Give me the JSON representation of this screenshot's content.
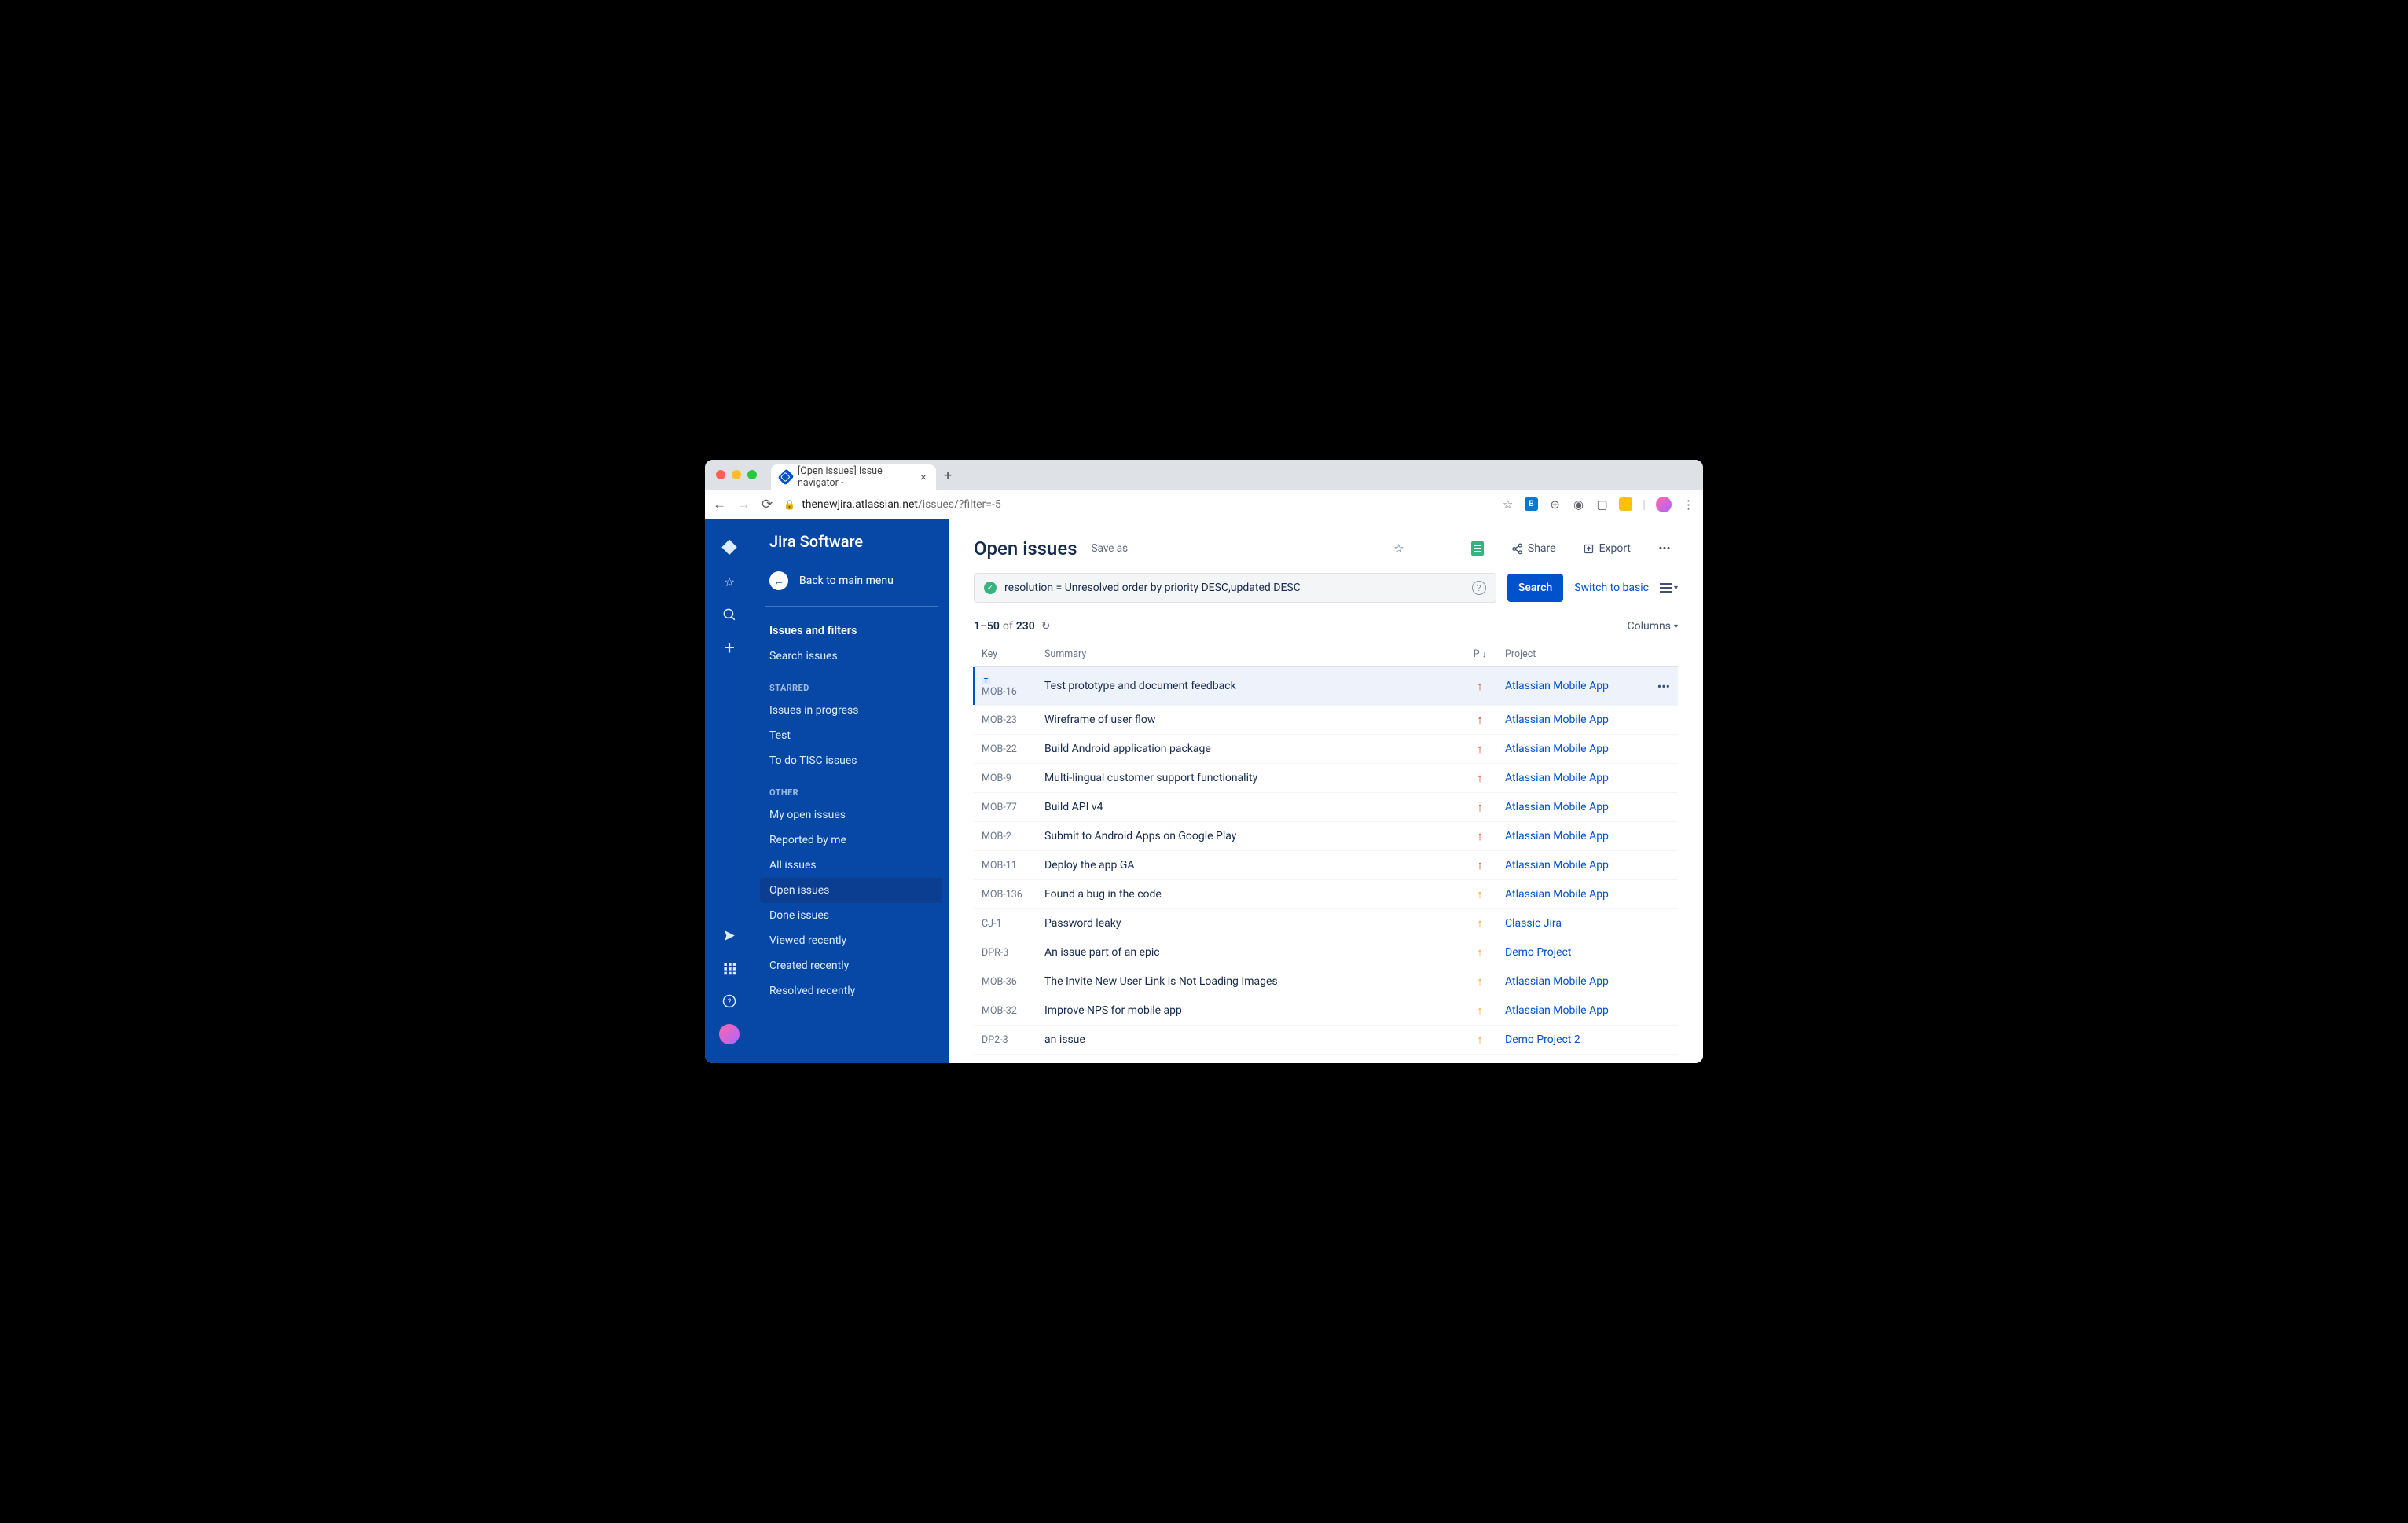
{
  "browser": {
    "tab_title": "[Open issues] Issue navigator - ",
    "url_host": "thenewjira.atlassian.net",
    "url_path": "/issues/?filter=-5"
  },
  "sidebar": {
    "brand": "Jira Software",
    "back": "Back to main menu",
    "section_head": "Issues and filters",
    "search_issues": "Search issues",
    "starred_label": "STARRED",
    "starred": [
      "Issues in progress",
      "Test",
      "To do TISC issues"
    ],
    "other_label": "OTHER",
    "other": [
      "My open issues",
      "Reported by me",
      "All issues",
      "Open issues",
      "Done issues",
      "Viewed recently",
      "Created recently",
      "Resolved recently"
    ],
    "active_other_index": 3
  },
  "header": {
    "title": "Open issues",
    "save_as": "Save as",
    "share": "Share",
    "export": "Export"
  },
  "query": {
    "jql": "resolution = Unresolved order by priority DESC,updated DESC",
    "search_btn": "Search",
    "switch": "Switch to basic"
  },
  "count": {
    "range": "1–50",
    "of_label": "of",
    "total": "230"
  },
  "columns_btn": "Columns",
  "columns": {
    "key": "Key",
    "summary": "Summary",
    "p": "P",
    "project": "Project"
  },
  "rows": [
    {
      "key": "MOB-16",
      "summary": "Test prototype and document feedback",
      "prio": "high",
      "project": "Atlassian Mobile App",
      "selected": true
    },
    {
      "key": "MOB-23",
      "summary": "Wireframe of user flow",
      "prio": "high",
      "project": "Atlassian Mobile App"
    },
    {
      "key": "MOB-22",
      "summary": "Build Android application package",
      "prio": "high",
      "project": "Atlassian Mobile App"
    },
    {
      "key": "MOB-9",
      "summary": "Multi-lingual customer support functionality",
      "prio": "high",
      "project": "Atlassian Mobile App"
    },
    {
      "key": "MOB-77",
      "summary": "Build API v4",
      "prio": "high",
      "project": "Atlassian Mobile App"
    },
    {
      "key": "MOB-2",
      "summary": "Submit to Android Apps on Google Play",
      "prio": "high",
      "project": "Atlassian Mobile App"
    },
    {
      "key": "MOB-11",
      "summary": "Deploy the app GA",
      "prio": "high",
      "project": "Atlassian Mobile App"
    },
    {
      "key": "MOB-136",
      "summary": "Found a bug in the code",
      "prio": "med",
      "project": "Atlassian Mobile App"
    },
    {
      "key": "CJ-1",
      "summary": "Password leaky",
      "prio": "med",
      "project": "Classic Jira"
    },
    {
      "key": "DPR-3",
      "summary": "An issue part of an epic",
      "prio": "med",
      "project": "Demo Project"
    },
    {
      "key": "MOB-36",
      "summary": "The Invite New User Link is Not Loading Images",
      "prio": "med",
      "project": "Atlassian Mobile App"
    },
    {
      "key": "MOB-32",
      "summary": "Improve NPS for mobile app",
      "prio": "med",
      "project": "Atlassian Mobile App"
    },
    {
      "key": "DP2-3",
      "summary": "an issue",
      "prio": "med",
      "project": "Demo Project 2"
    }
  ]
}
